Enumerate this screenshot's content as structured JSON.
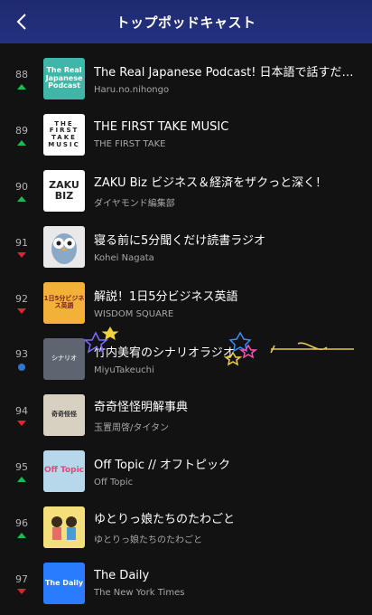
{
  "header": {
    "title": "トップポッドキャスト",
    "back_icon": "chevron-left-icon"
  },
  "colors": {
    "header_bg": "#233181",
    "up": "#1db954",
    "down": "#e22134",
    "new": "#2e77d0"
  },
  "items": [
    {
      "rank": "88",
      "trend": "up",
      "name": "The Real Japanese Podcast! 日本語で話すだけの…",
      "author": "Haru.no.nihongo",
      "thumb": "The Real Japanese Podcast"
    },
    {
      "rank": "89",
      "trend": "up",
      "name": "THE FIRST TAKE MUSIC",
      "author": "THE FIRST TAKE",
      "thumb": "THE FIRST TAKE MUSIC"
    },
    {
      "rank": "90",
      "trend": "up",
      "name": "ZAKU Biz ビジネス＆経済をザクっと深く！",
      "author": "ダイヤモンド編集部",
      "thumb": "ZAKU BIZ"
    },
    {
      "rank": "91",
      "trend": "down",
      "name": "寝る前に5分聞くだけ読書ラジオ",
      "author": "Kohei Nagata",
      "thumb": ""
    },
    {
      "rank": "92",
      "trend": "down",
      "name": "解説！1日5分ビジネス英語",
      "author": "WISDOM SQUARE",
      "thumb": "1日5分ビジネス英語"
    },
    {
      "rank": "93",
      "trend": "new",
      "name": "竹内美宥のシナリオラジオ",
      "author": "MiyuTakeuchi",
      "thumb": "シナリオ"
    },
    {
      "rank": "94",
      "trend": "down",
      "name": "奇奇怪怪明解事典",
      "author": "玉置周啓/タイタン",
      "thumb": "奇奇怪怪"
    },
    {
      "rank": "95",
      "trend": "up",
      "name": "Off Topic // オフトピック",
      "author": "Off Topic",
      "thumb": "Off Topic"
    },
    {
      "rank": "96",
      "trend": "up",
      "name": "ゆとりっ娘たちのたわごと",
      "author": "ゆとりっ娘たちのたわごと",
      "thumb": ""
    },
    {
      "rank": "97",
      "trend": "down",
      "name": "The Daily",
      "author": "The New York Times",
      "thumb": "The Daily"
    }
  ]
}
